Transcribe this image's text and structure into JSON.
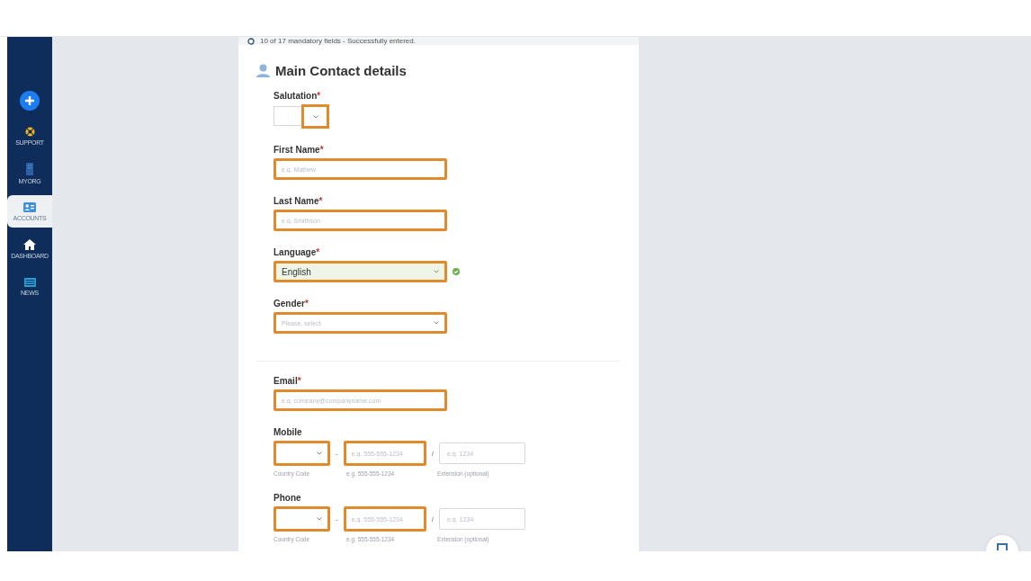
{
  "sidebar": {
    "items": [
      {
        "kind": "support",
        "label": "SUPPORT",
        "selected": false
      },
      {
        "kind": "org",
        "label": "MYORG",
        "selected": false
      },
      {
        "kind": "accounts",
        "label": "ACCOUNTS",
        "selected": true
      },
      {
        "kind": "home",
        "label": "DASHBOARD",
        "selected": false
      },
      {
        "kind": "news",
        "label": "NEWS",
        "selected": false
      }
    ]
  },
  "status": {
    "text": "10 of 17 mandatory fields - Successfully entered."
  },
  "form": {
    "title": "Main Contact details",
    "sections": [
      {
        "fields": [
          {
            "kind": "salutation",
            "label": "Salutation",
            "required_mark": "*",
            "highlighted": true
          },
          {
            "kind": "text",
            "label": "First Name",
            "required_mark": "*",
            "placeholder": "e.g. Mathew",
            "highlighted": true,
            "valid": false
          },
          {
            "kind": "text",
            "label": "Last Name",
            "required_mark": "*",
            "placeholder": "e.g. Smithson",
            "highlighted": true,
            "valid": false
          },
          {
            "kind": "select",
            "label": "Language",
            "required_mark": "*",
            "value": "English",
            "highlighted": true,
            "valid": true
          },
          {
            "kind": "select",
            "label": "Gender",
            "required_mark": "*",
            "placeholder": "Please, select",
            "highlighted": true,
            "valid": false
          }
        ]
      },
      {
        "fields": [
          {
            "kind": "text",
            "label": "Email",
            "required_mark": "*",
            "placeholder": "e.g. company@companyname.com",
            "highlighted": true,
            "valid": false
          },
          {
            "kind": "phone",
            "label": "Mobile",
            "separator": "-",
            "slash": "/",
            "country": {
              "highlighted": true,
              "helper": "Country Code"
            },
            "number": {
              "placeholder": "e.g. 555-555-1234",
              "highlighted": true,
              "helper": "e.g. 555-555-1234"
            },
            "extension": {
              "placeholder": "e.g. 1234",
              "highlighted": false,
              "helper": "Extension (optional)"
            }
          },
          {
            "kind": "phone",
            "label": "Phone",
            "separator": "-",
            "slash": "/",
            "country": {
              "highlighted": true,
              "helper": "Country Code"
            },
            "number": {
              "placeholder": "e.g. 555-555-1234",
              "highlighted": true,
              "helper": "e.g. 555-555-1234"
            },
            "extension": {
              "placeholder": "e.g. 1234",
              "highlighted": false,
              "helper": "Extension (optional)"
            }
          }
        ]
      }
    ]
  }
}
